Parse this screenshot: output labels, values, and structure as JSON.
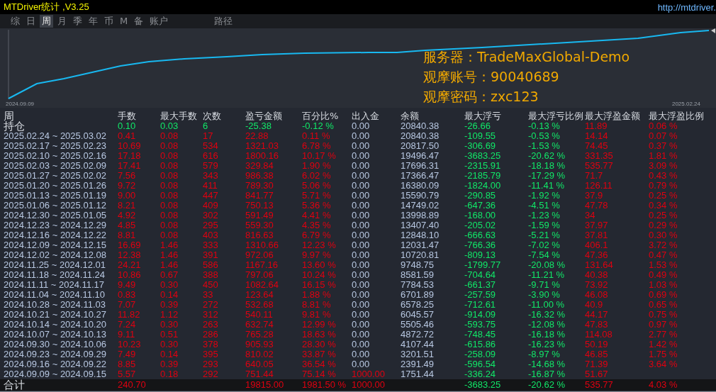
{
  "window": {
    "title": "MTDriver统计 ,V3.25",
    "url": "http://mtdriver."
  },
  "tabs": [
    {
      "label": "综",
      "selected": false,
      "kind": "period"
    },
    {
      "label": "日",
      "selected": false,
      "kind": "period"
    },
    {
      "label": "周",
      "selected": true,
      "kind": "period"
    },
    {
      "label": "月",
      "selected": false,
      "kind": "period"
    },
    {
      "label": "季",
      "selected": false,
      "kind": "period"
    },
    {
      "label": "年",
      "selected": false,
      "kind": "period"
    },
    {
      "label": "币",
      "selected": false,
      "kind": "period"
    },
    {
      "label": "M",
      "selected": false,
      "kind": "period"
    },
    {
      "label": "备",
      "selected": false,
      "kind": "period"
    },
    {
      "label": "账户",
      "selected": false,
      "kind": "period"
    },
    {
      "label": "路径",
      "selected": false,
      "kind": "path"
    }
  ],
  "chart": {
    "start_label": "2024.09.09",
    "end_label": "2025.02.24",
    "overlay": [
      "服务器：TradeMaxGlobal-Demo",
      "观摩账号：90040689",
      "观摩密码：zxc123"
    ]
  },
  "table": {
    "columns": [
      "周",
      "手数",
      "最大手数",
      "次数",
      "盈亏金额",
      "百分比%",
      "出入金",
      "余额",
      "最大浮亏",
      "最大浮亏比例",
      "最大浮盈金额",
      "最大浮盈比例"
    ],
    "rows": [
      {
        "kind": "open",
        "deposit": false,
        "cells": [
          "持仓",
          "0.10",
          "0.03",
          "6",
          "-25.38",
          "-0.12 %",
          "0.00",
          "20840.38",
          "-26.66",
          "-0.13 %",
          "11.89",
          "0.06 %"
        ]
      },
      {
        "kind": "week",
        "deposit": false,
        "cells": [
          "2025.02.24 ~ 2025.03.02",
          "0.41",
          "0.08",
          "17",
          "22.88",
          "0.11 %",
          "0.00",
          "20840.38",
          "-109.55",
          "-0.53 %",
          "14.14",
          "0.07 %"
        ]
      },
      {
        "kind": "week",
        "deposit": false,
        "cells": [
          "2025.02.17 ~ 2025.02.23",
          "10.69",
          "0.08",
          "534",
          "1321.03",
          "6.78 %",
          "0.00",
          "20817.50",
          "-306.69",
          "-1.53 %",
          "74.45",
          "0.37 %"
        ]
      },
      {
        "kind": "week",
        "deposit": false,
        "cells": [
          "2025.02.10 ~ 2025.02.16",
          "17.18",
          "0.08",
          "616",
          "1800.16",
          "10.17 %",
          "0.00",
          "19496.47",
          "-3683.25",
          "-20.62 %",
          "331.35",
          "1.81 %"
        ]
      },
      {
        "kind": "week",
        "deposit": false,
        "cells": [
          "2025.02.03 ~ 2025.02.09",
          "17.41",
          "0.08",
          "579",
          "329.84",
          "1.90 %",
          "0.00",
          "17696.31",
          "-2315.91",
          "-18.18 %",
          "535.77",
          "3.09 %"
        ]
      },
      {
        "kind": "week",
        "deposit": false,
        "cells": [
          "2025.01.27 ~ 2025.02.02",
          "7.56",
          "0.08",
          "343",
          "986.38",
          "6.02 %",
          "0.00",
          "17366.47",
          "-2185.79",
          "-17.29 %",
          "71.7",
          "0.43 %"
        ]
      },
      {
        "kind": "week",
        "deposit": false,
        "cells": [
          "2025.01.20 ~ 2025.01.26",
          "9.72",
          "0.08",
          "411",
          "789.30",
          "5.06 %",
          "0.00",
          "16380.09",
          "-1824.00",
          "-11.41 %",
          "126.11",
          "0.79 %"
        ]
      },
      {
        "kind": "week",
        "deposit": false,
        "cells": [
          "2025.01.13 ~ 2025.01.19",
          "9.00",
          "0.08",
          "447",
          "841.77",
          "5.71 %",
          "0.00",
          "15590.79",
          "-290.85",
          "-1.92 %",
          "37.9",
          "0.25 %"
        ]
      },
      {
        "kind": "week",
        "deposit": false,
        "cells": [
          "2025.01.06 ~ 2025.01.12",
          "8.21",
          "0.08",
          "409",
          "750.13",
          "5.36 %",
          "0.00",
          "14749.02",
          "-647.36",
          "-4.51 %",
          "47.78",
          "0.34 %"
        ]
      },
      {
        "kind": "week",
        "deposit": false,
        "cells": [
          "2024.12.30 ~ 2025.01.05",
          "4.92",
          "0.08",
          "302",
          "591.49",
          "4.41 %",
          "0.00",
          "13998.89",
          "-168.00",
          "-1.23 %",
          "34",
          "0.25 %"
        ]
      },
      {
        "kind": "week",
        "deposit": false,
        "cells": [
          "2024.12.23 ~ 2024.12.29",
          "4.85",
          "0.08",
          "295",
          "559.30",
          "4.35 %",
          "0.00",
          "13407.40",
          "-205.02",
          "-1.59 %",
          "37.97",
          "0.29 %"
        ]
      },
      {
        "kind": "week",
        "deposit": false,
        "cells": [
          "2024.12.16 ~ 2024.12.22",
          "8.81",
          "0.08",
          "403",
          "816.63",
          "6.79 %",
          "0.00",
          "12848.10",
          "-666.63",
          "-5.21 %",
          "37.81",
          "0.30 %"
        ]
      },
      {
        "kind": "week",
        "deposit": false,
        "cells": [
          "2024.12.09 ~ 2024.12.15",
          "16.69",
          "1.46",
          "333",
          "1310.66",
          "12.23 %",
          "0.00",
          "12031.47",
          "-766.36",
          "-7.02 %",
          "406.1",
          "3.72 %"
        ]
      },
      {
        "kind": "week",
        "deposit": false,
        "cells": [
          "2024.12.02 ~ 2024.12.08",
          "12.38",
          "1.46",
          "391",
          "972.06",
          "9.97 %",
          "0.00",
          "10720.81",
          "-809.13",
          "-7.54 %",
          "47.36",
          "0.47 %"
        ]
      },
      {
        "kind": "week",
        "deposit": false,
        "cells": [
          "2024.11.25 ~ 2024.12.01",
          "24.21",
          "1.46",
          "586",
          "1167.16",
          "13.60 %",
          "0.00",
          "9748.75",
          "-1799.77",
          "-20.08 %",
          "131.64",
          "1.53 %"
        ]
      },
      {
        "kind": "week",
        "deposit": false,
        "cells": [
          "2024.11.18 ~ 2024.11.24",
          "10.86",
          "0.67",
          "388",
          "797.06",
          "10.24 %",
          "0.00",
          "8581.59",
          "-704.64",
          "-11.21 %",
          "40.38",
          "0.49 %"
        ]
      },
      {
        "kind": "week",
        "deposit": false,
        "cells": [
          "2024.11.11 ~ 2024.11.17",
          "9.49",
          "0.30",
          "450",
          "1082.64",
          "16.15 %",
          "0.00",
          "7784.53",
          "-661.37",
          "-9.71 %",
          "73.92",
          "1.03 %"
        ]
      },
      {
        "kind": "week",
        "deposit": false,
        "cells": [
          "2024.11.04 ~ 2024.11.10",
          "0.83",
          "0.14",
          "33",
          "123.64",
          "1.88 %",
          "0.00",
          "6701.89",
          "-257.59",
          "-3.90 %",
          "46.08",
          "0.69 %"
        ]
      },
      {
        "kind": "week",
        "deposit": false,
        "cells": [
          "2024.10.28 ~ 2024.11.03",
          "7.07",
          "0.39",
          "272",
          "532.68",
          "8.81 %",
          "0.00",
          "6578.25",
          "-712.61",
          "-11.00 %",
          "40.9",
          "0.65 %"
        ]
      },
      {
        "kind": "week",
        "deposit": false,
        "cells": [
          "2024.10.21 ~ 2024.10.27",
          "11.82",
          "1.12",
          "312",
          "540.11",
          "9.81 %",
          "0.00",
          "6045.57",
          "-914.09",
          "-16.32 %",
          "44.17",
          "0.75 %"
        ]
      },
      {
        "kind": "week",
        "deposit": false,
        "cells": [
          "2024.10.14 ~ 2024.10.20",
          "7.24",
          "0.30",
          "263",
          "632.74",
          "12.99 %",
          "0.00",
          "5505.46",
          "-593.75",
          "-12.08 %",
          "47.83",
          "0.97 %"
        ]
      },
      {
        "kind": "week",
        "deposit": false,
        "cells": [
          "2024.10.07 ~ 2024.10.13",
          "9.11",
          "0.51",
          "286",
          "765.28",
          "18.63 %",
          "0.00",
          "4872.72",
          "-748.45",
          "-16.18 %",
          "114.08",
          "2.77 %"
        ]
      },
      {
        "kind": "week",
        "deposit": false,
        "cells": [
          "2024.09.30 ~ 2024.10.06",
          "10.23",
          "0.30",
          "378",
          "905.93",
          "28.30 %",
          "0.00",
          "4107.44",
          "-615.86",
          "-16.23 %",
          "50.19",
          "1.42 %"
        ]
      },
      {
        "kind": "week",
        "deposit": false,
        "cells": [
          "2024.09.23 ~ 2024.09.29",
          "7.49",
          "0.14",
          "395",
          "810.02",
          "33.87 %",
          "0.00",
          "3201.51",
          "-258.09",
          "-8.97 %",
          "46.85",
          "1.75 %"
        ]
      },
      {
        "kind": "week",
        "deposit": false,
        "cells": [
          "2024.09.16 ~ 2024.09.22",
          "8.85",
          "0.39",
          "293",
          "640.05",
          "36.54 %",
          "0.00",
          "2391.49",
          "-596.54",
          "-14.68 %",
          "71.39",
          "3.64 %"
        ]
      },
      {
        "kind": "week",
        "deposit": true,
        "cells": [
          "2024.09.09 ~ 2024.09.15",
          "5.57",
          "0.18",
          "292",
          "751.44",
          "75.14 %",
          "1000.00",
          "1751.44",
          "-336.24",
          "-16.87 %",
          "51.67"
        ]
      },
      {
        "kind": "total",
        "deposit": true,
        "cells": [
          "合计",
          "240.70",
          null,
          null,
          "19815.00",
          "1981.50 %",
          "1000.00",
          null,
          "-3683.25",
          "-20.62 %",
          "535.77",
          "4.03 %"
        ]
      }
    ]
  }
}
